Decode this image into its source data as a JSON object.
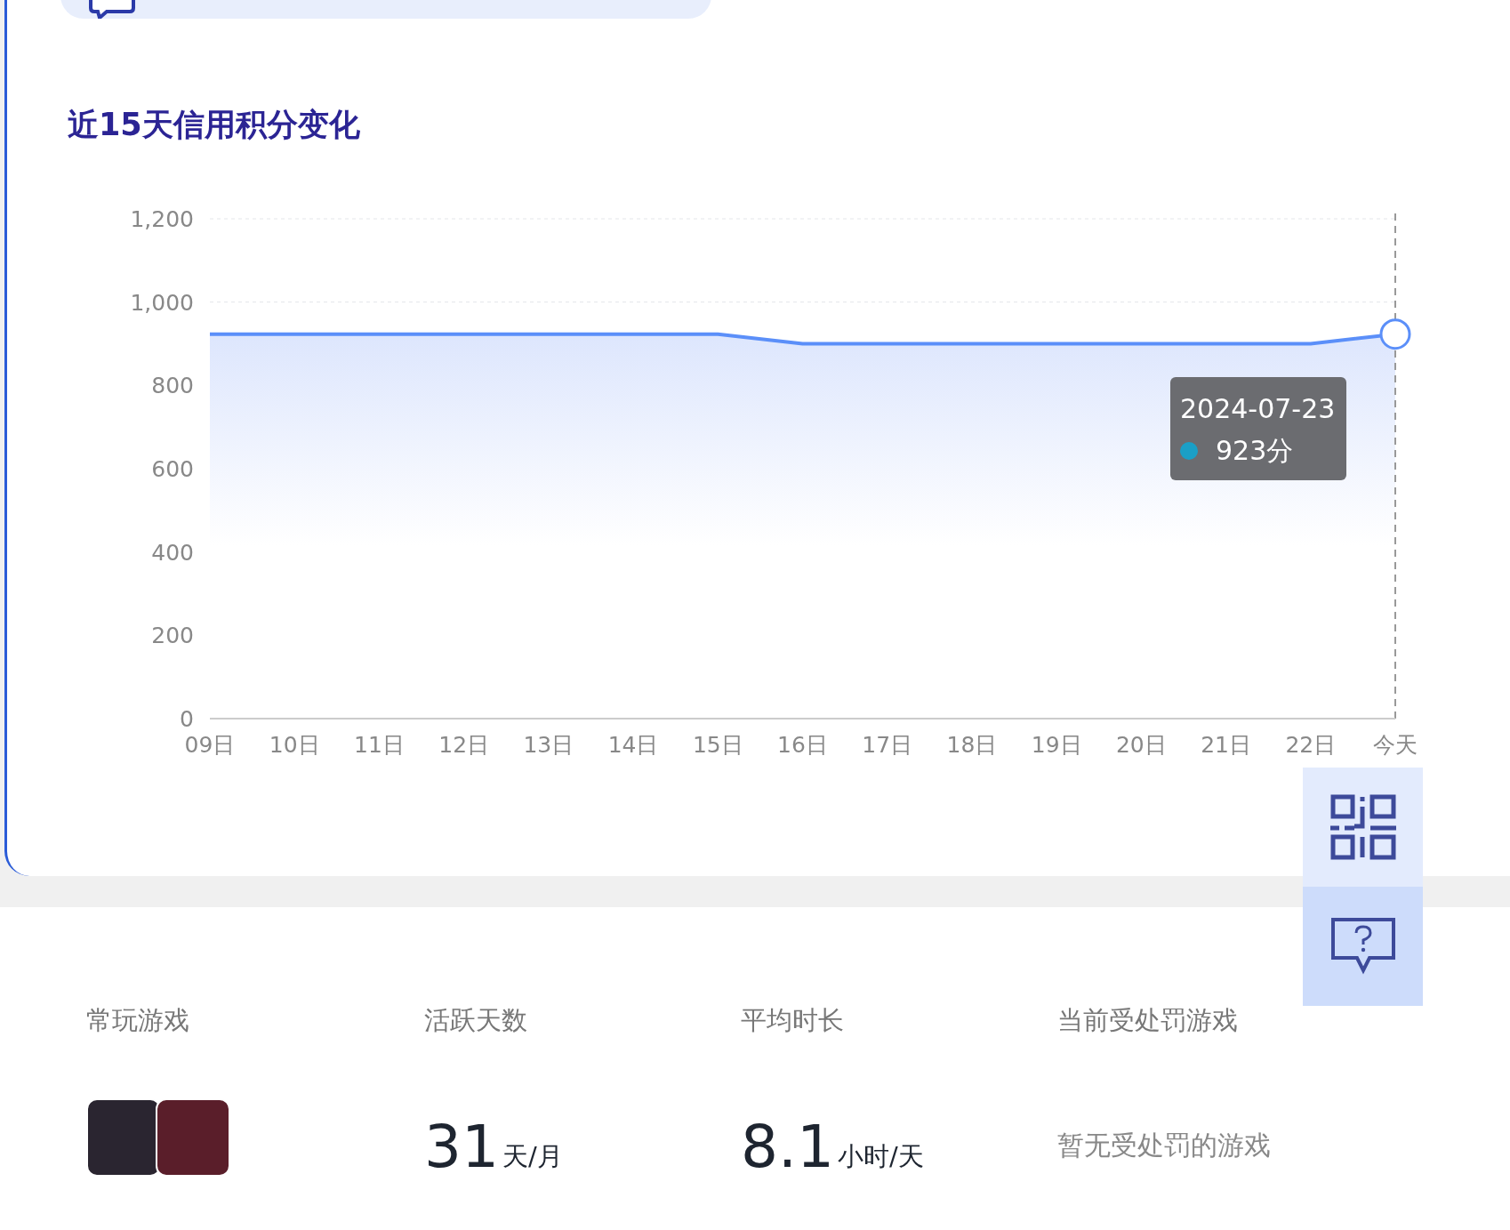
{
  "chart_section": {
    "title": "近15天信用积分变化",
    "chart_data": {
      "type": "area",
      "categories": [
        "09日",
        "10日",
        "11日",
        "12日",
        "13日",
        "14日",
        "15日",
        "16日",
        "17日",
        "18日",
        "19日",
        "20日",
        "21日",
        "22日",
        "今天"
      ],
      "series": [
        {
          "color": "#5b8ff9",
          "values": [
            923,
            923,
            923,
            923,
            923,
            923,
            923,
            900,
            900,
            900,
            900,
            900,
            900,
            900,
            923
          ]
        }
      ],
      "ylim": [
        0,
        1200
      ],
      "yticks": [
        0,
        {
          "value": 200,
          "label": "200"
        },
        {
          "value": 400,
          "label": "400"
        },
        {
          "value": 600,
          "label": "600"
        },
        {
          "value": 800,
          "label": "800"
        },
        {
          "value": 1000,
          "label": "1,000"
        },
        {
          "value": 1200,
          "label": "1,200"
        }
      ]
    },
    "tooltip": {
      "date": "2024-07-23",
      "value": "923分",
      "color": "#1a9fc6"
    }
  },
  "stats": [
    {
      "kind": "games",
      "label": "常玩游戏"
    },
    {
      "kind": "number",
      "label": "活跃天数",
      "value": "31",
      "unit": "天/月"
    },
    {
      "kind": "number",
      "label": "平均时长",
      "value": "8.1",
      "unit": "小时/天"
    },
    {
      "kind": "text",
      "label": "当前受处罚游戏",
      "text": "暂无受处罚的游戏"
    }
  ]
}
